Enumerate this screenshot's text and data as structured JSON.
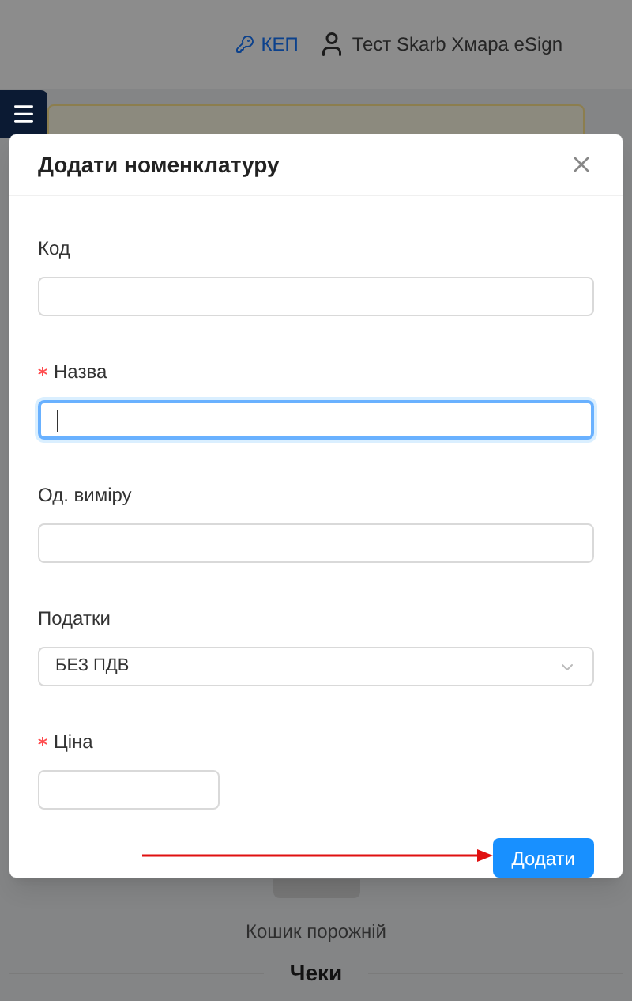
{
  "header": {
    "key_link": "КЕП",
    "user_name": "Тест Skarb Хмара eSign"
  },
  "dialog": {
    "title": "Додати номенклатуру",
    "fields": [
      {
        "kind": "text",
        "label": "Код",
        "required": false,
        "focused": false
      },
      {
        "kind": "text",
        "label": "Назва",
        "required": true,
        "focused": true
      },
      {
        "kind": "text",
        "label": "Од. виміру",
        "required": false,
        "focused": false
      },
      {
        "kind": "select",
        "label": "Податки",
        "required": false,
        "focused": false,
        "value": "БЕЗ ПДВ"
      },
      {
        "kind": "short_text",
        "label": "Ціна",
        "required": true,
        "focused": false
      }
    ],
    "submit_button": "Додати"
  },
  "background": {
    "cart_status": "Кошик порожній",
    "section_title": "Чеки"
  }
}
